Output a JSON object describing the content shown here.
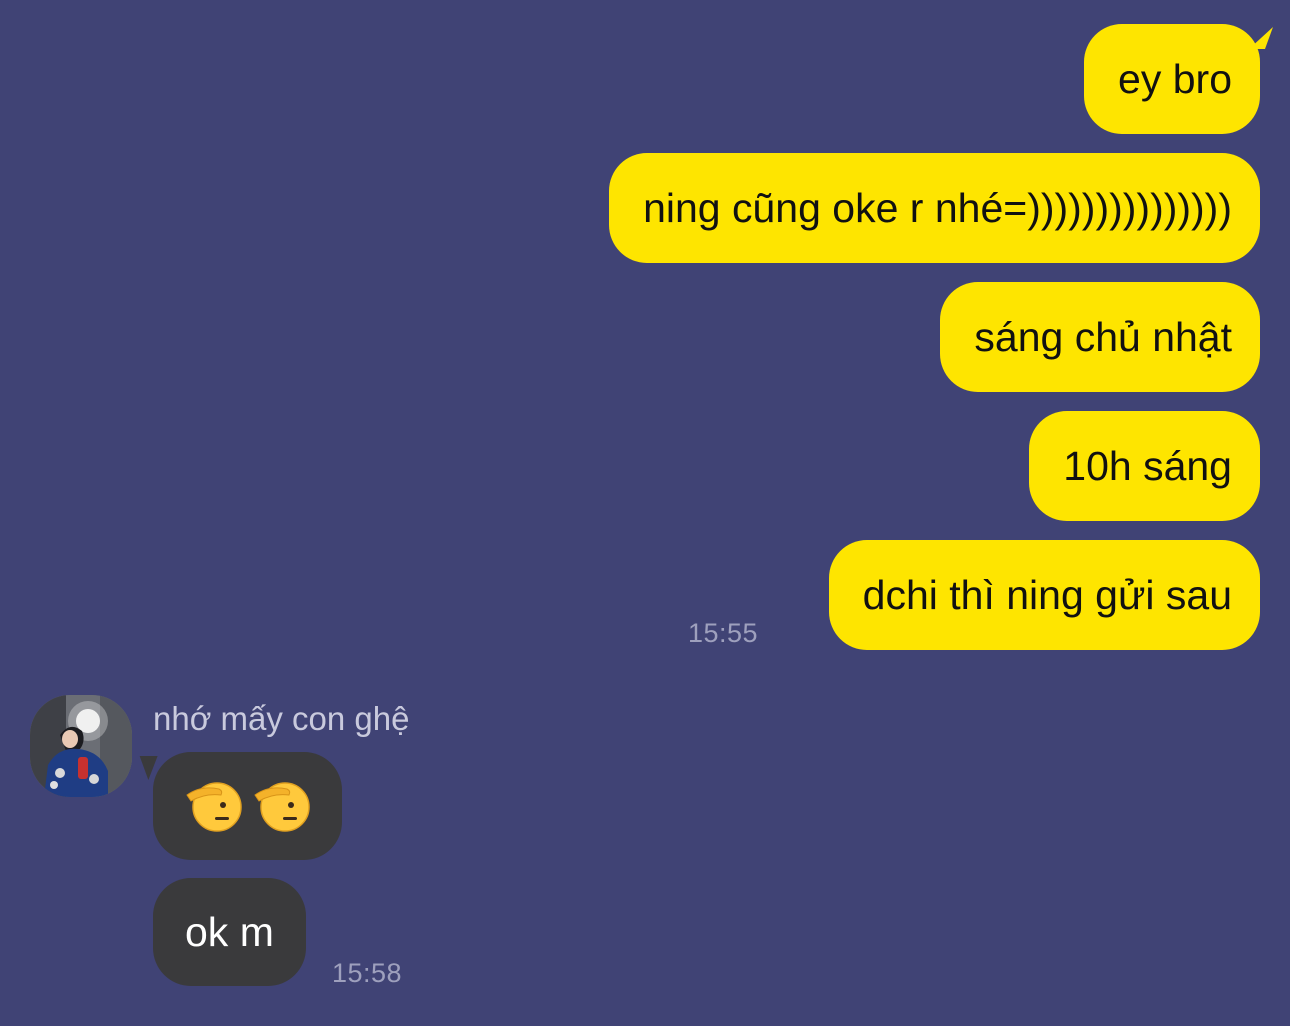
{
  "colors": {
    "background": "#404375",
    "outgoing_bubble": "#FEE500",
    "incoming_bubble": "#3A3A3C"
  },
  "outgoing": [
    {
      "text": "ey bro"
    },
    {
      "text": "ning cũng oke r nhé=)))))))))))))))"
    },
    {
      "text": "sáng chủ nhật"
    },
    {
      "text": "10h sáng"
    },
    {
      "text": "dchi thì ning gửi sau"
    }
  ],
  "outgoing_time": "15:55",
  "incoming": {
    "sender_name": "nhớ mấy con ghệ",
    "avatar_icon": "profile-photo",
    "messages": [
      {
        "emoji": [
          "saluting-face",
          "saluting-face"
        ]
      },
      {
        "text": "ok m"
      }
    ],
    "time": "15:58"
  }
}
